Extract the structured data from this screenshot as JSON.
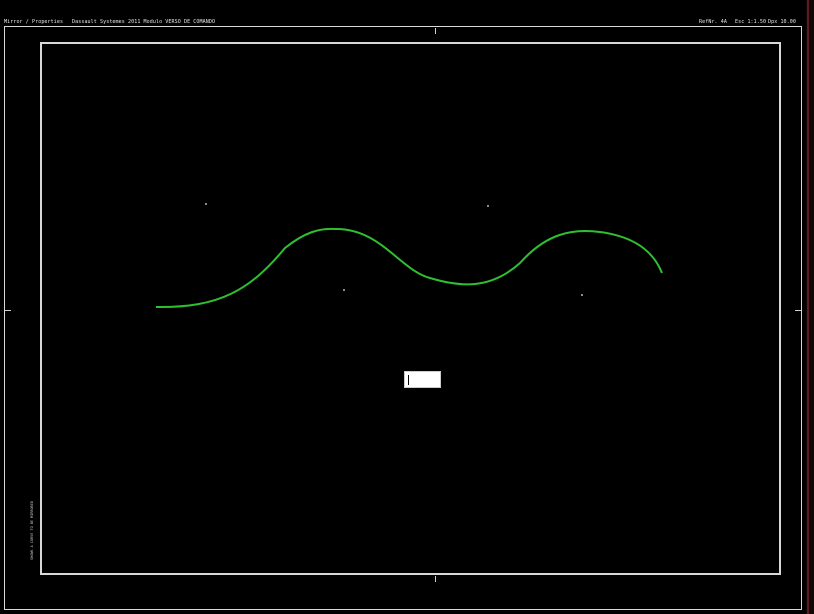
{
  "header": {
    "left_text": "Mirror / Properties",
    "title_text": "Dassault Systemes 2011  Modulo VERSO DE COMANDO",
    "right_1": "RefNr. 4A",
    "right_2": "Esc 1:1.50",
    "right_3": "Dpx 10.00"
  },
  "vertical_label": "SHOWS A CURVE TO BE MIRRORED",
  "colors": {
    "background": "#000000",
    "frame": "#d8d8d8",
    "curve": "#2fbf2f"
  },
  "command_input": {
    "value": ""
  }
}
